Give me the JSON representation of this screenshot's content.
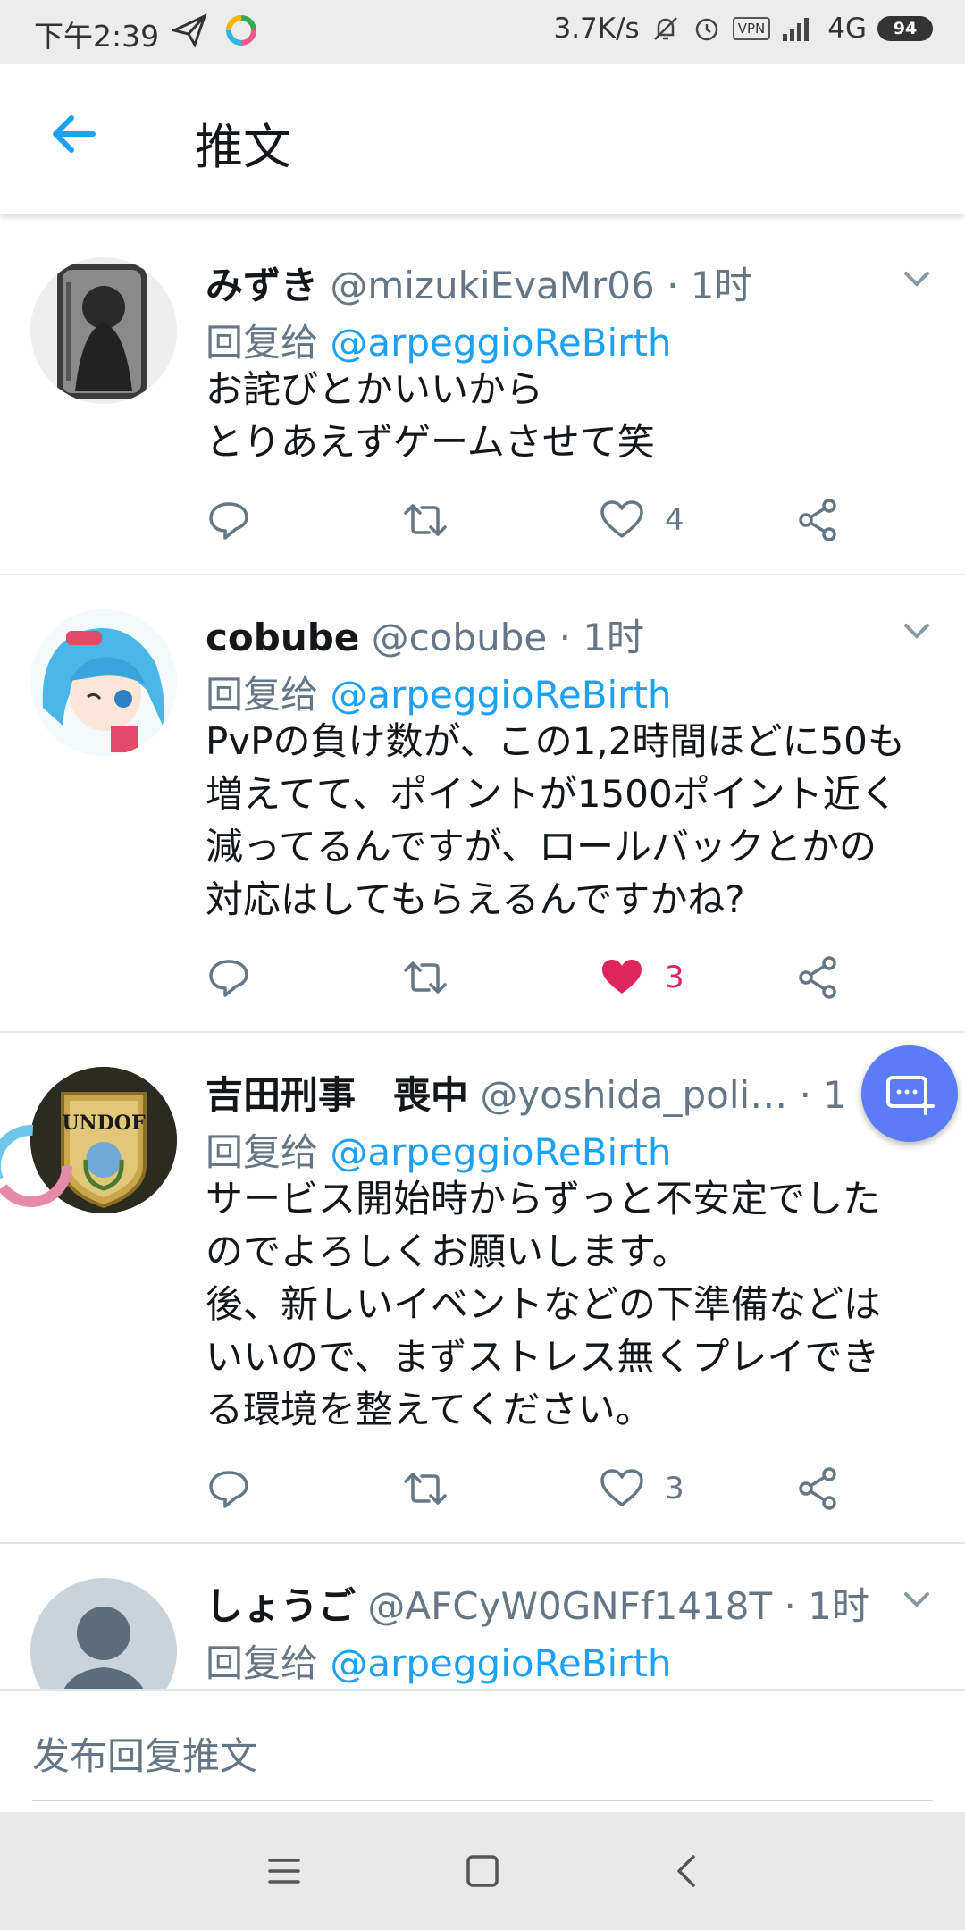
{
  "status_bar": {
    "time": "下午2:39",
    "net_speed": "3.7K/s",
    "vpn": "VPN",
    "network": "4G",
    "battery": "94"
  },
  "header": {
    "title": "推文"
  },
  "tweets": [
    {
      "name": "みずき",
      "handle": "@mizukiEvaMr06",
      "time": "· 1时",
      "reply_prefix": "回复给",
      "reply_to": "@arpeggioReBirth",
      "lines": [
        "お詫びとかいいから",
        "とりあえずゲームさせて笑"
      ],
      "likes": "4",
      "liked": false
    },
    {
      "name": "cobube",
      "handle": "@cobube",
      "time": "· 1时",
      "reply_prefix": "回复给",
      "reply_to": "@arpeggioReBirth",
      "lines": [
        "PvPの負け数が、この1,2時間ほどに50も",
        "増えてて、ポイントが1500ポイント近く",
        "減ってるんですが、ロールバックとかの",
        "対応はしてもらえるんですかね?"
      ],
      "likes": "3",
      "liked": true
    },
    {
      "name": "吉田刑事　喪中",
      "handle": "@yoshida_poli…",
      "time": "· 1时",
      "reply_prefix": "回复给",
      "reply_to": "@arpeggioReBirth",
      "lines": [
        "サービス開始時からずっと不安定でした",
        "のでよろしくお願いします。",
        "後、新しいイベントなどの下準備などは",
        "いいので、まずストレス無くプレイでき",
        "る環境を整えてください。"
      ],
      "likes": "3",
      "liked": false
    },
    {
      "name": "しょうご",
      "handle": "@AFCyW0GNFf1418T",
      "time": "· 1时",
      "reply_prefix": "回复给",
      "reply_to": "@arpeggioReBirth",
      "lines": [],
      "likes": "",
      "liked": false
    }
  ],
  "avatar_labels": {
    "undof": "UNDOF"
  },
  "compose": {
    "placeholder": "发布回复推文"
  },
  "colors": {
    "accent": "#1da1f2",
    "like": "#e0245e",
    "fab": "#5c7cf7"
  }
}
